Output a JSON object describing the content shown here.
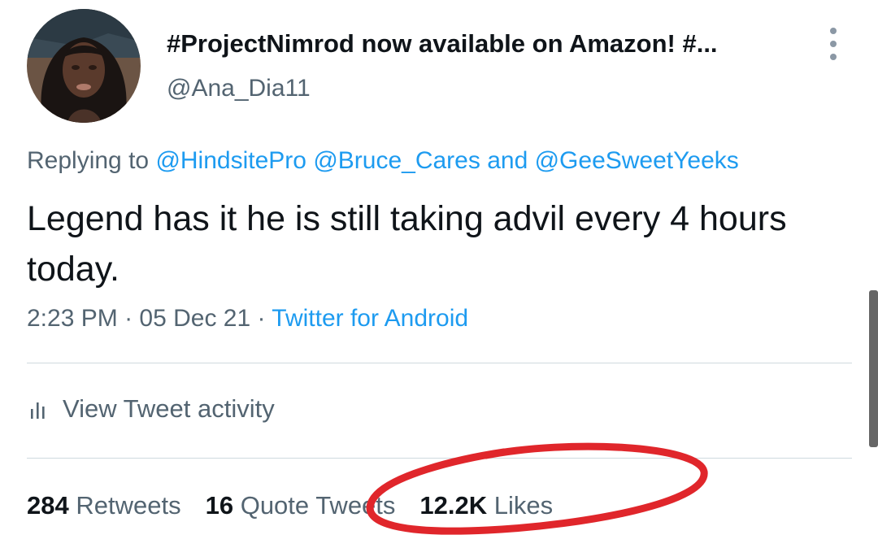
{
  "tweet": {
    "display_name": "#ProjectNimrod now available on Amazon! #...",
    "handle": "@Ana_Dia11",
    "replying_prefix": "Replying to ",
    "reply_mentions": [
      "@HindsitePro",
      "@Bruce_Cares"
    ],
    "reply_and": " and ",
    "reply_last": "@GeeSweetYeeks",
    "text": "Legend has it he is still taking advil every 4 hours today.",
    "time": "2:23 PM",
    "date": "05 Dec 21",
    "separator": " · ",
    "source": "Twitter for Android"
  },
  "activity": {
    "label": "View Tweet activity"
  },
  "stats": {
    "retweets_count": "284",
    "retweets_label": "Retweets",
    "quotes_count": "16",
    "quotes_label": "Quote Tweets",
    "likes_count": "12.2K",
    "likes_label": "Likes"
  },
  "colors": {
    "link": "#1d9bf0",
    "secondary": "#536471",
    "annotation": "#e0262b"
  },
  "icons": {
    "more": "more-vertical-icon",
    "activity": "bar-chart-icon"
  }
}
